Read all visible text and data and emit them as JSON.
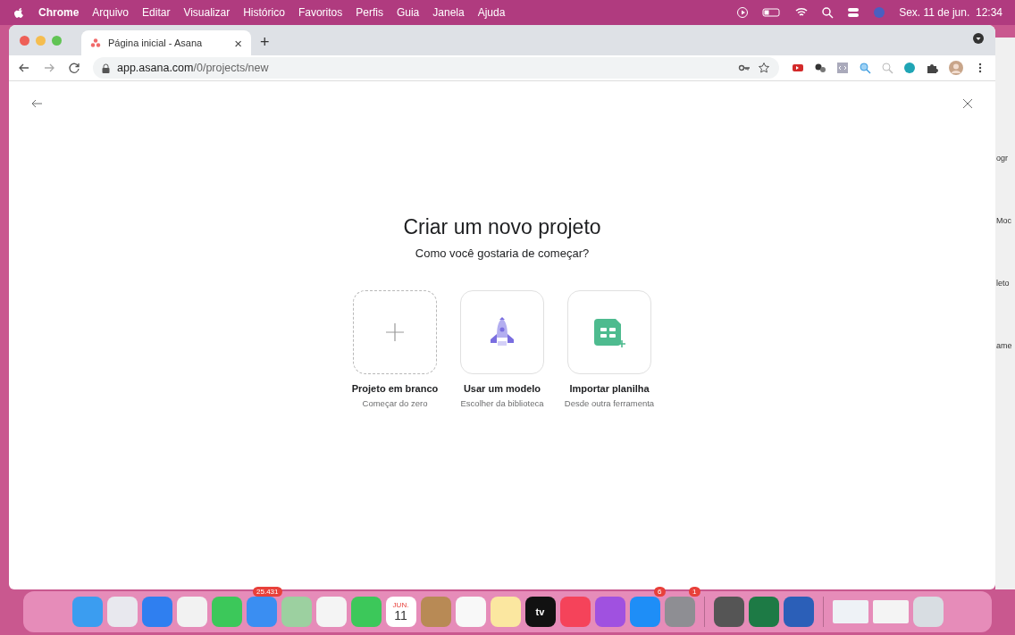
{
  "menu_bar": {
    "app": "Chrome",
    "items": [
      "Arquivo",
      "Editar",
      "Visualizar",
      "Histórico",
      "Favoritos",
      "Perfis",
      "Guia",
      "Janela",
      "Ajuda"
    ],
    "clock": "Sex. 11 de jun.  12:34"
  },
  "browser": {
    "tab": {
      "title": "Página inicial - Asana",
      "close": "×",
      "selected": true
    },
    "new_tab": "+",
    "url_host": "app.asana.com",
    "url_path": "/0/projects/new"
  },
  "page": {
    "title": "Criar um novo projeto",
    "subtitle": "Como você gostaria de começar?",
    "options": [
      {
        "kind": "blank",
        "label": "Projeto em branco",
        "caption": "Começar do zero"
      },
      {
        "kind": "template",
        "label": "Usar um modelo",
        "caption": "Escolher da biblioteca"
      },
      {
        "kind": "import",
        "label": "Importar planilha",
        "caption": "Desde outra ferramenta"
      }
    ]
  },
  "background_window": {
    "texts": [
      "ogr",
      "Moc",
      "leto",
      "ame"
    ]
  },
  "dock": [
    {
      "kind": "app",
      "color": "#3b9df0"
    },
    {
      "kind": "app",
      "color": "#e8e8ee"
    },
    {
      "kind": "app",
      "color": "#2f7ff0"
    },
    {
      "kind": "app",
      "color": "#f2f2f2"
    },
    {
      "kind": "app",
      "color": "#3cc85a"
    },
    {
      "kind": "app",
      "color": "#3a8ef2",
      "badge": "25.431"
    },
    {
      "kind": "app",
      "color": "#9cd0a0"
    },
    {
      "kind": "app",
      "color": "#f4f4f4"
    },
    {
      "kind": "app",
      "color": "#3cc85a"
    },
    {
      "kind": "calendar",
      "color": "#ffffff",
      "month": "JUN.",
      "day": "11"
    },
    {
      "kind": "app",
      "color": "#b88a55"
    },
    {
      "kind": "app",
      "color": "#f8f8f8"
    },
    {
      "kind": "app",
      "color": "#fbe7a0"
    },
    {
      "kind": "tv",
      "color": "#111111",
      "text": "tv"
    },
    {
      "kind": "app",
      "color": "#f5435a"
    },
    {
      "kind": "app",
      "color": "#a051e0"
    },
    {
      "kind": "app",
      "color": "#1e8ef7",
      "badge": "6"
    },
    {
      "kind": "app",
      "color": "#8e8e93",
      "badge": "1"
    },
    {
      "kind": "separator"
    },
    {
      "kind": "app",
      "color": "#555555"
    },
    {
      "kind": "app",
      "color": "#1d7a45"
    },
    {
      "kind": "app",
      "color": "#2b5fb8"
    },
    {
      "kind": "separator"
    },
    {
      "kind": "window",
      "color": "#eef2f6"
    },
    {
      "kind": "window",
      "color": "#f4f4f4"
    },
    {
      "kind": "app",
      "color": "#d8dde2"
    }
  ]
}
